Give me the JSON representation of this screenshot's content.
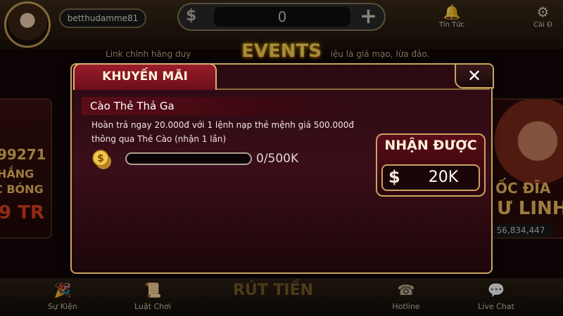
{
  "header": {
    "username": "betthudamme81",
    "balance": "0",
    "balance_currency_icon": "$",
    "add_icon": "+",
    "news_label": "Tin Tức",
    "settings_label": "Cài Đ",
    "marquee_text": "Link chính hãng duy                                                    iệu là giả mạo, lừa đảo.",
    "events_logo_text": "EVENTS"
  },
  "background_cards": {
    "left_lines": [
      "99271",
      "HẮNG",
      "C BÓNG",
      "9 TR"
    ],
    "right_lines": [
      "ỐC ĐĨA",
      "Ư LINH"
    ],
    "right_number": "56,834,447"
  },
  "bottom_nav": {
    "items": [
      {
        "label": "Sự Kiện",
        "icon": "event-icon"
      },
      {
        "label": "Luật Chơi",
        "icon": "rules-icon"
      },
      {
        "label": "Hotline",
        "icon": "phone-icon"
      },
      {
        "label": "Live Chat",
        "icon": "chat-icon"
      }
    ],
    "center_label": "RÚT TIỀN"
  },
  "modal": {
    "tab_title": "KHUYẾN MÃI",
    "close_icon": "✕",
    "promotion": {
      "title": "Cào Thẻ Thả Ga",
      "description": "Hoàn trả ngay 20.000đ với 1 lệnh nạp thẻ mệnh giá 500.000đ thông qua Thẻ Cào (nhận 1 lần)",
      "progress_text": "0/500K",
      "progress_fraction": 0
    },
    "receive": {
      "title": "NHẬN ĐƯỢC",
      "currency_icon": "$",
      "amount": "20K"
    }
  },
  "colors": {
    "accent_gold": "#c9a45c",
    "tab_red": "#9a1c2a",
    "modal_bg": "#2a0a12"
  }
}
